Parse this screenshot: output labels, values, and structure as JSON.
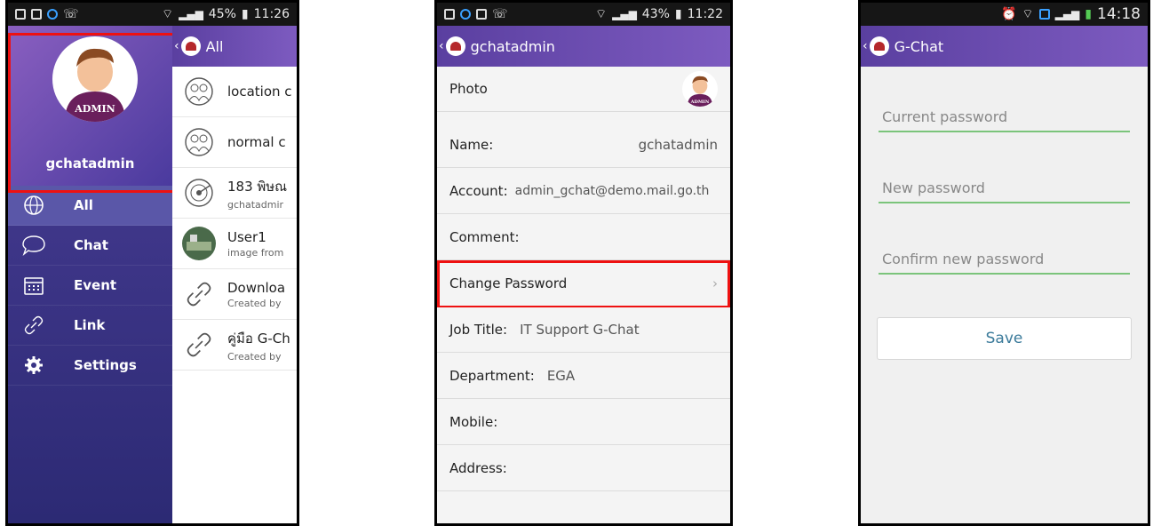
{
  "screen1": {
    "status": {
      "battery": "45%",
      "time": "11:26"
    },
    "drawer": {
      "avatar_text": "ADMIN",
      "username": "gchatadmin",
      "items": [
        {
          "label": "All",
          "icon": "globe-icon"
        },
        {
          "label": "Chat",
          "icon": "chat-bubble-icon"
        },
        {
          "label": "Event",
          "icon": "calendar-icon"
        },
        {
          "label": "Link",
          "icon": "link-icon"
        },
        {
          "label": "Settings",
          "icon": "gear-icon"
        }
      ]
    },
    "list_header": "All",
    "list": [
      {
        "title": "location c",
        "sub": "",
        "icon": "group-icon"
      },
      {
        "title": "normal c",
        "sub": "",
        "icon": "group-icon"
      },
      {
        "title": "183 พิษณ",
        "sub": "gchatadmir",
        "icon": "radar-icon"
      },
      {
        "title": "User1",
        "sub": "image from",
        "icon": "photo-thumbnail"
      },
      {
        "title": "Downloa",
        "sub": "Created by",
        "icon": "link-icon"
      },
      {
        "title": "คู่มือ G-Ch",
        "sub": "Created by",
        "icon": "link-icon"
      }
    ]
  },
  "screen2": {
    "status": {
      "battery": "43%",
      "time": "11:22"
    },
    "title": "gchatadmin",
    "avatar_text": "ADMIN",
    "rows": {
      "photo": "Photo",
      "name_label": "Name:",
      "name_value": "gchatadmin",
      "account_label": "Account:",
      "account_value": "admin_gchat@demo.mail.go.th",
      "comment_label": "Comment:",
      "change_password": "Change Password",
      "chevron": "›",
      "job_label": "Job Title:",
      "job_value": "IT Support G-Chat",
      "dept_label": "Department:",
      "dept_value": "EGA",
      "mobile_label": "Mobile:",
      "address_label": "Address:"
    }
  },
  "screen3": {
    "status": {
      "time": "14:18"
    },
    "title": "G-Chat",
    "fields": {
      "current": "Current password",
      "new": "New password",
      "confirm": "Confirm new password"
    },
    "save_label": "Save"
  }
}
